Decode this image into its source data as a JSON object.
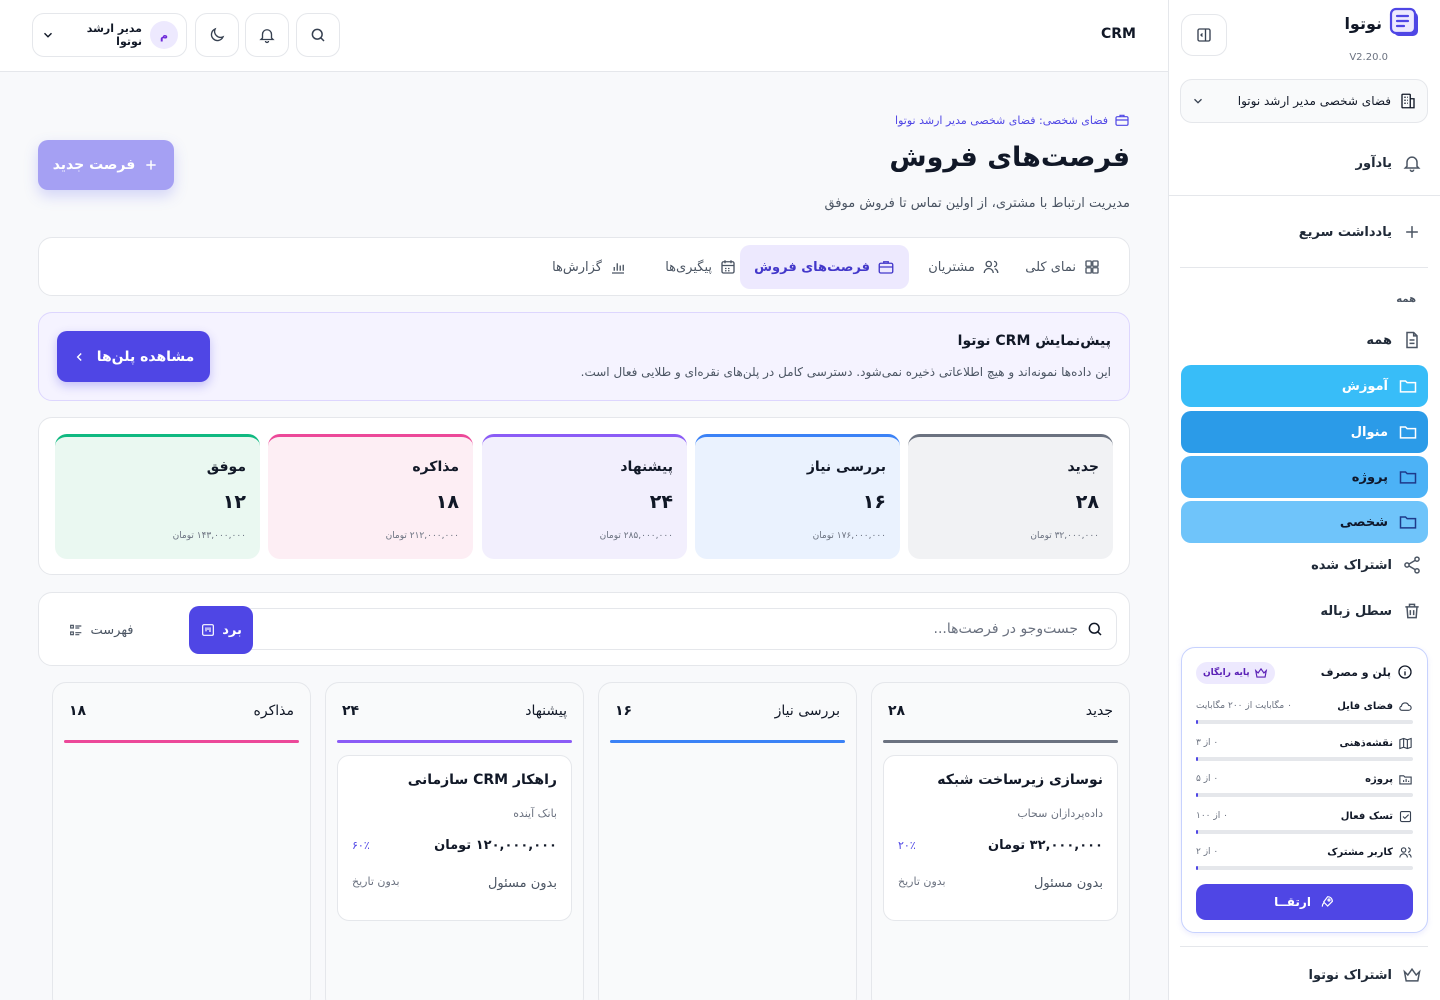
{
  "sidebar": {
    "app_name": "نوتوا",
    "version": "V2.20.0",
    "workspace": "فضای شخصی مدیر ارشد نوتوا",
    "reminder": "یادآور",
    "quick_note": "یادداشت سریع",
    "section_label": "همه",
    "all": "همه",
    "folders": [
      {
        "label": "آموزش",
        "color": "#38bdf8"
      },
      {
        "label": "منوال",
        "color": "#2b9be8"
      },
      {
        "label": "پروژه",
        "color": "#4cb2f6"
      },
      {
        "label": "شخصی",
        "color": "#6fc4fa"
      }
    ],
    "shared": "اشتراک شده",
    "trash": "سطل زباله",
    "plan": {
      "title": "پلن و مصرف",
      "badge": "پایه رایگان",
      "usage": [
        {
          "name": "فضای فایل",
          "value": "۰ مگابایت از ۲۰۰ مگابایت",
          "icon": "cloud-icon",
          "level": 0.01
        },
        {
          "name": "نقشه‌ذهنی",
          "value": "۰ از ۳",
          "icon": "map-icon",
          "level": 0.01
        },
        {
          "name": "پروژه",
          "value": "۰ از ۵",
          "icon": "folder-chart-icon",
          "level": 0.01
        },
        {
          "name": "تسک فعال",
          "value": "۰ از ۱۰۰",
          "icon": "check-square-icon",
          "level": 0.01
        },
        {
          "name": "کاربر مشترک",
          "value": "۰ از ۲",
          "icon": "users-icon",
          "level": 0.01
        }
      ],
      "upgrade": "ارتقــا"
    },
    "subscription": "اشتراک نوتوا"
  },
  "topbar": {
    "title": "CRM",
    "user_initial": "م",
    "user_name": "مدیر ارشد نوتوا"
  },
  "main": {
    "breadcrumb": "فضای شخصی: فضای شخصی مدیر ارشد نوتوا",
    "title": "فرصت‌های فروش",
    "subtitle": "مدیریت ارتباط با مشتری، از اولین تماس تا فروش موفق",
    "new_button": "فرصت جدید",
    "tabs": [
      {
        "label": "نمای کلی",
        "icon": "grid-icon"
      },
      {
        "label": "مشتریان",
        "icon": "users-icon"
      },
      {
        "label": "فرصت‌های فروش",
        "icon": "briefcase-icon",
        "active": true
      },
      {
        "label": "پیگیری‌ها",
        "icon": "calendar-icon"
      },
      {
        "label": "گزارش‌ها",
        "icon": "chart-icon"
      }
    ],
    "promo": {
      "title": "پیش‌نمایش CRM نوتوا",
      "text": "این داده‌ها نمونه‌اند و هیچ اطلاعاتی ذخیره نمی‌شود. دسترسی کامل در پلن‌های نقره‌ای و طلایی فعال است.",
      "button": "مشاهده پلن‌ها"
    },
    "stages": [
      {
        "name": "جدید",
        "count": "۲۸",
        "amount": "۳۲,۰۰۰,۰۰۰ تومان",
        "color": "#6b7280",
        "bg": "#f1f2f4"
      },
      {
        "name": "بررسی نیاز",
        "count": "۱۶",
        "amount": "۱۷۶,۰۰۰,۰۰۰ تومان",
        "color": "#3b82f6",
        "bg": "#eaf2fe"
      },
      {
        "name": "پیشنهاد",
        "count": "۲۴",
        "amount": "۲۸۵,۰۰۰,۰۰۰ تومان",
        "color": "#8b5cf6",
        "bg": "#f2effd"
      },
      {
        "name": "مذاکره",
        "count": "۱۸",
        "amount": "۲۱۲,۰۰۰,۰۰۰ تومان",
        "color": "#ec4899",
        "bg": "#fdeef4"
      },
      {
        "name": "موفق",
        "count": "۱۲",
        "amount": "۱۴۳,۰۰۰,۰۰۰ تومان",
        "color": "#10b981",
        "bg": "#eaf8f1"
      }
    ],
    "search_placeholder": "جست‌وجو در فرصت‌ها...",
    "view_board": "برد",
    "view_list": "فهرست",
    "board": [
      {
        "name": "جدید",
        "count": "۲۸",
        "color": "#6b7280",
        "card": {
          "title": "نوسازی زیرساخت شبکه",
          "company": "داده‌پردازان سحاب",
          "amount": "۳۲,۰۰۰,۰۰۰ تومان",
          "prob": "۲۰٪",
          "owner": "بدون مسئول",
          "date": "بدون تاریخ"
        }
      },
      {
        "name": "بررسی نیاز",
        "count": "۱۶",
        "color": "#3b82f6"
      },
      {
        "name": "پیشنهاد",
        "count": "۲۴",
        "color": "#8b5cf6",
        "card": {
          "title": "راهکار CRM سازمانی",
          "company": "بانک آینده",
          "amount": "۱۲۰,۰۰۰,۰۰۰ تومان",
          "prob": "۶۰٪",
          "owner": "بدون مسئول",
          "date": "بدون تاریخ"
        }
      },
      {
        "name": "مذاکره",
        "count": "۱۸",
        "color": "#ec4899"
      }
    ]
  }
}
